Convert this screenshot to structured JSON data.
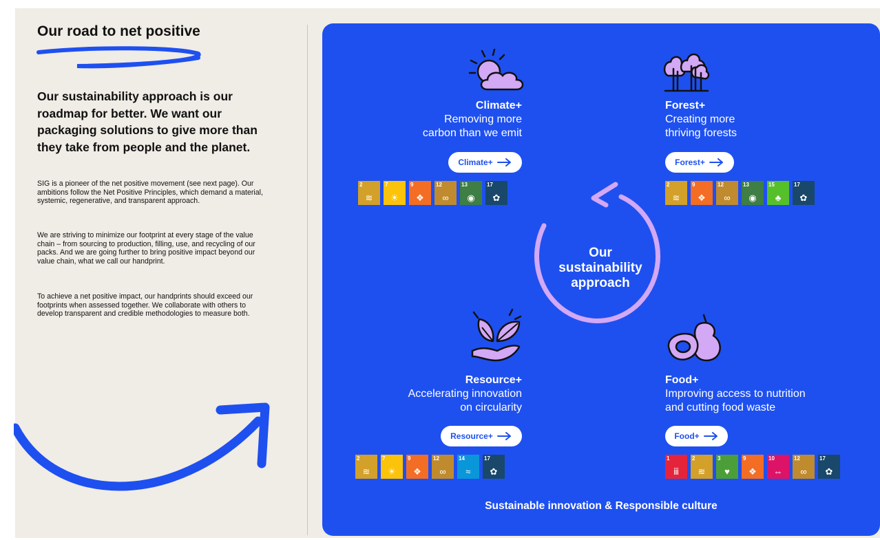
{
  "left": {
    "title": "Our road to net positive",
    "lead": "Our sustainability approach is our roadmap for better. We want our packaging solutions to give more than they take from people and the planet.",
    "paragraphs": [
      "SIG is a pioneer of the net positive movement (see next page). Our ambitions follow the Net Positive Principles, which demand a material, systemic, regenerative, and transparent approach.",
      "We are striving to minimize our footprint at every stage of the value chain – from sourcing to production, filling, use, and recycling of our packs. And we are going further to bring positive impact beyond our value chain, what we call our handprint.",
      "To achieve a net positive impact, our handprints should exceed our footprints when assessed together. We collaborate with others to develop transparent and credible methodologies to measure both."
    ]
  },
  "center": {
    "line1": "Our",
    "line2": "sustainability",
    "line3": "approach"
  },
  "quadrants": {
    "climate": {
      "title": "Climate+",
      "sub1": "Removing more",
      "sub2": "carbon than we emit",
      "button": "Climate+",
      "icon": "sun-cloud-icon",
      "sdgs": [
        {
          "num": "2",
          "color": "#d3a029",
          "glyph": "≋"
        },
        {
          "num": "7",
          "color": "#fcc30b",
          "glyph": "☀"
        },
        {
          "num": "9",
          "color": "#f36d25",
          "glyph": "❖"
        },
        {
          "num": "12",
          "color": "#bf8b2e",
          "glyph": "∞"
        },
        {
          "num": "13",
          "color": "#3f7e44",
          "glyph": "◉"
        },
        {
          "num": "17",
          "color": "#19486a",
          "glyph": "✿"
        }
      ]
    },
    "forest": {
      "title": "Forest+",
      "sub1": "Creating more",
      "sub2": "thriving forests",
      "button": "Forest+",
      "icon": "trees-icon",
      "sdgs": [
        {
          "num": "2",
          "color": "#d3a029",
          "glyph": "≋"
        },
        {
          "num": "9",
          "color": "#f36d25",
          "glyph": "❖"
        },
        {
          "num": "12",
          "color": "#bf8b2e",
          "glyph": "∞"
        },
        {
          "num": "13",
          "color": "#3f7e44",
          "glyph": "◉"
        },
        {
          "num": "15",
          "color": "#56c02b",
          "glyph": "♣"
        },
        {
          "num": "17",
          "color": "#19486a",
          "glyph": "✿"
        }
      ]
    },
    "resource": {
      "title": "Resource+",
      "sub1": "Accelerating innovation",
      "sub2": "on circularity",
      "button": "Resource+",
      "icon": "hand-leaves-icon",
      "sdgs": [
        {
          "num": "2",
          "color": "#d3a029",
          "glyph": "≋"
        },
        {
          "num": "7",
          "color": "#fcc30b",
          "glyph": "☀"
        },
        {
          "num": "9",
          "color": "#f36d25",
          "glyph": "❖"
        },
        {
          "num": "12",
          "color": "#bf8b2e",
          "glyph": "∞"
        },
        {
          "num": "14",
          "color": "#0a97d9",
          "glyph": "≈"
        },
        {
          "num": "17",
          "color": "#19486a",
          "glyph": "✿"
        }
      ]
    },
    "food": {
      "title": "Food+",
      "sub1": "Improving access to nutrition",
      "sub2": "and cutting food waste",
      "button": "Food+",
      "icon": "pear-avocado-icon",
      "sdgs": [
        {
          "num": "1",
          "color": "#e5243b",
          "glyph": "ⅲ"
        },
        {
          "num": "2",
          "color": "#d3a029",
          "glyph": "≋"
        },
        {
          "num": "3",
          "color": "#4c9f38",
          "glyph": "♥"
        },
        {
          "num": "9",
          "color": "#f36d25",
          "glyph": "❖"
        },
        {
          "num": "10",
          "color": "#dd1367",
          "glyph": "⇔"
        },
        {
          "num": "12",
          "color": "#bf8b2e",
          "glyph": "∞"
        },
        {
          "num": "17",
          "color": "#19486a",
          "glyph": "✿"
        }
      ]
    }
  },
  "footer": "Sustainable innovation & Responsible culture",
  "colors": {
    "panel": "#1e50f0",
    "accent": "#d3a8f5",
    "page": "#f0ece6"
  }
}
